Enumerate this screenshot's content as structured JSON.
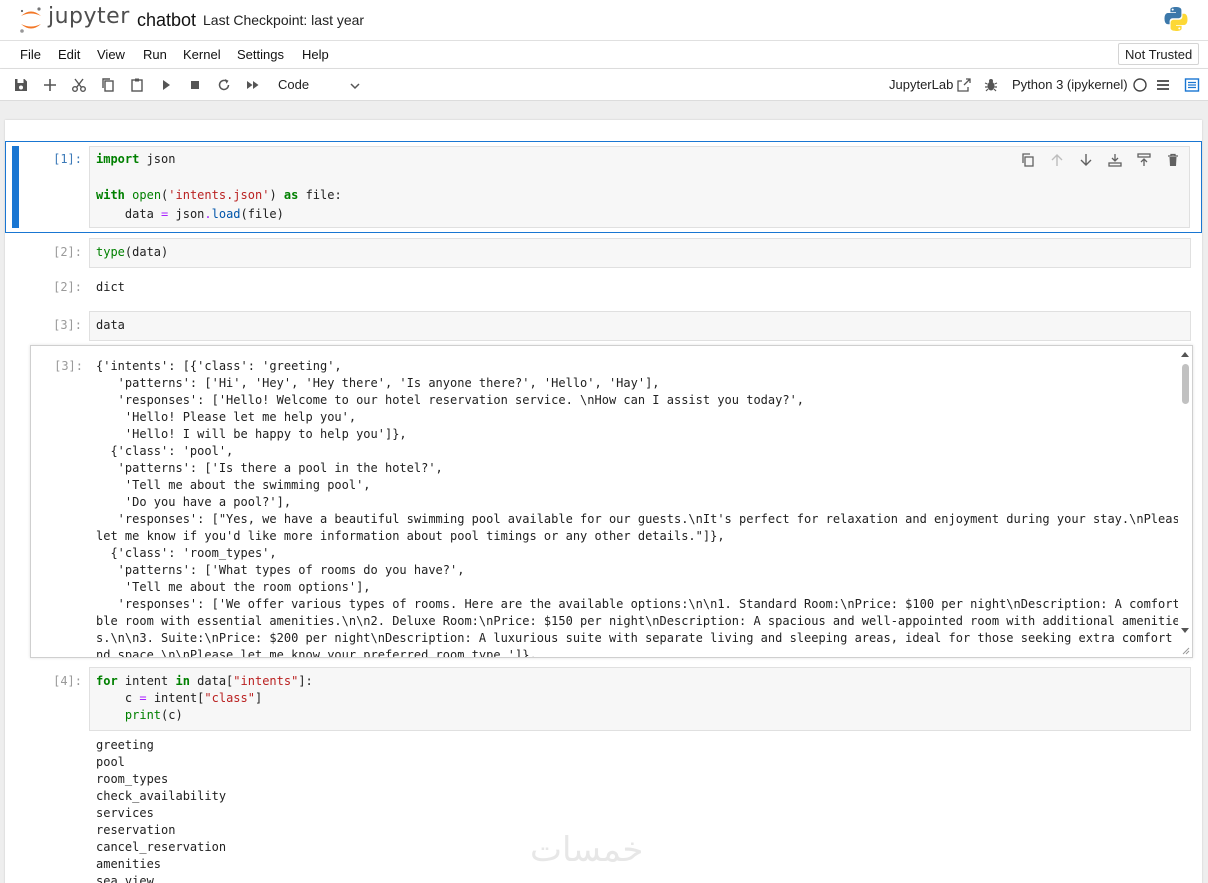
{
  "header": {
    "logo_text": "jupyter",
    "notebook_title": "chatbot",
    "checkpoint": "Last Checkpoint: last year"
  },
  "menu": {
    "items": [
      "File",
      "Edit",
      "View",
      "Run",
      "Kernel",
      "Settings",
      "Help"
    ],
    "trust_status": "Not Trusted"
  },
  "toolbar": {
    "cell_type": "Code",
    "jupyterlab_link": "JupyterLab",
    "kernel": "Python 3 (ipykernel)",
    "icons": [
      "save-icon",
      "add-icon",
      "cut-icon",
      "copy-icon",
      "paste-icon",
      "run-icon",
      "stop-icon",
      "restart-icon",
      "fast-forward-icon"
    ]
  },
  "cells": [
    {
      "prompt": "[1]:",
      "code": [
        "import json",
        "",
        "with open('intents.json') as file:",
        "    data = json.load(file)"
      ]
    },
    {
      "prompt": "[2]:",
      "code": [
        "type(data)"
      ],
      "output_prompt": "[2]:",
      "output": "dict"
    },
    {
      "prompt": "[3]:",
      "code": [
        "data"
      ],
      "output_prompt": "[3]:",
      "output_lines": [
        "{'intents': [{'class': 'greeting',",
        "   'patterns': ['Hi', 'Hey', 'Hey there', 'Is anyone there?', 'Hello', 'Hay'],",
        "   'responses': ['Hello! Welcome to our hotel reservation service. \\nHow can I assist you today?',",
        "    'Hello! Please let me help you',",
        "    'Hello! I will be happy to help you']},",
        "  {'class': 'pool',",
        "   'patterns': ['Is there a pool in the hotel?',",
        "    'Tell me about the swimming pool',",
        "    'Do you have a pool?'],",
        "   'responses': [\"Yes, we have a beautiful swimming pool available for our guests.\\nIt's perfect for relaxation and enjoyment during your stay.\\nPlease",
        "let me know if you'd like more information about pool timings or any other details.\"]},",
        "  {'class': 'room_types',",
        "   'patterns': ['What types of rooms do you have?',",
        "    'Tell me about the room options'],",
        "   'responses': ['We offer various types of rooms. Here are the available options:\\n\\n1. Standard Room:\\nPrice: $100 per night\\nDescription: A comforta",
        "ble room with essential amenities.\\n\\n2. Deluxe Room:\\nPrice: $150 per night\\nDescription: A spacious and well-appointed room with additional amenitie",
        "s.\\n\\n3. Suite:\\nPrice: $200 per night\\nDescription: A luxurious suite with separate living and sleeping areas, ideal for those seeking extra comfort a",
        "nd space.\\n\\nPlease let me know your preferred room type.']},"
      ]
    },
    {
      "prompt": "[4]:",
      "code": [
        "for intent in data[\"intents\"]:",
        "    c = intent[\"class\"]",
        "    print(c)"
      ],
      "output_lines": [
        "greeting",
        "pool",
        "room_types",
        "check_availability",
        "services",
        "reservation",
        "cancel_reservation",
        "amenities",
        "sea_view"
      ]
    }
  ],
  "colors": {
    "active_cell": "#1976d2",
    "keyword": "#008000",
    "string": "#ba2121"
  }
}
